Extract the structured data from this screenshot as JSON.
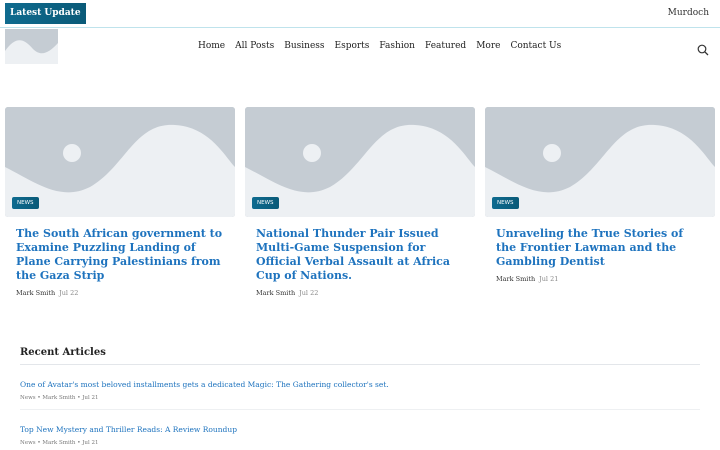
{
  "topbar": {
    "badge_label": "Latest  Update",
    "brand": "Murdoch"
  },
  "nav": {
    "items": [
      "Home",
      "All Posts",
      "Business",
      "Esports",
      "Fashion",
      "Featured",
      "More",
      "Contact Us"
    ]
  },
  "cards": [
    {
      "tag": "NEWS",
      "title": "The South African government to Examine Puzzling Landing of Plane Carrying Palestinians from the Gaza Strip",
      "author": "Mark Smith",
      "date": "Jul 22"
    },
    {
      "tag": "NEWS",
      "title": "National Thunder Pair Issued Multi-Game Suspension for Official Verbal Assault at Africa Cup of Nations.",
      "author": "Mark Smith",
      "date": "Jul 22"
    },
    {
      "tag": "NEWS",
      "title": "Unraveling the True Stories of the Frontier Lawman and the Gambling Dentist",
      "author": "Mark Smith",
      "date": "Jul 21"
    }
  ],
  "recent": {
    "heading": "Recent Articles",
    "items": [
      {
        "title": "One of Avatar's most beloved installments gets a dedicated Magic: The Gathering collector's set.",
        "meta": "News • Mark Smith • Jul 21"
      },
      {
        "title": "Top New Mystery and Thriller Reads: A Review Roundup",
        "meta": "News • Mark Smith • Jul 21"
      }
    ]
  },
  "colors": {
    "accent": "#1e73be",
    "badge": "#0f6b8f",
    "placeholder": "#c5ccd3"
  }
}
